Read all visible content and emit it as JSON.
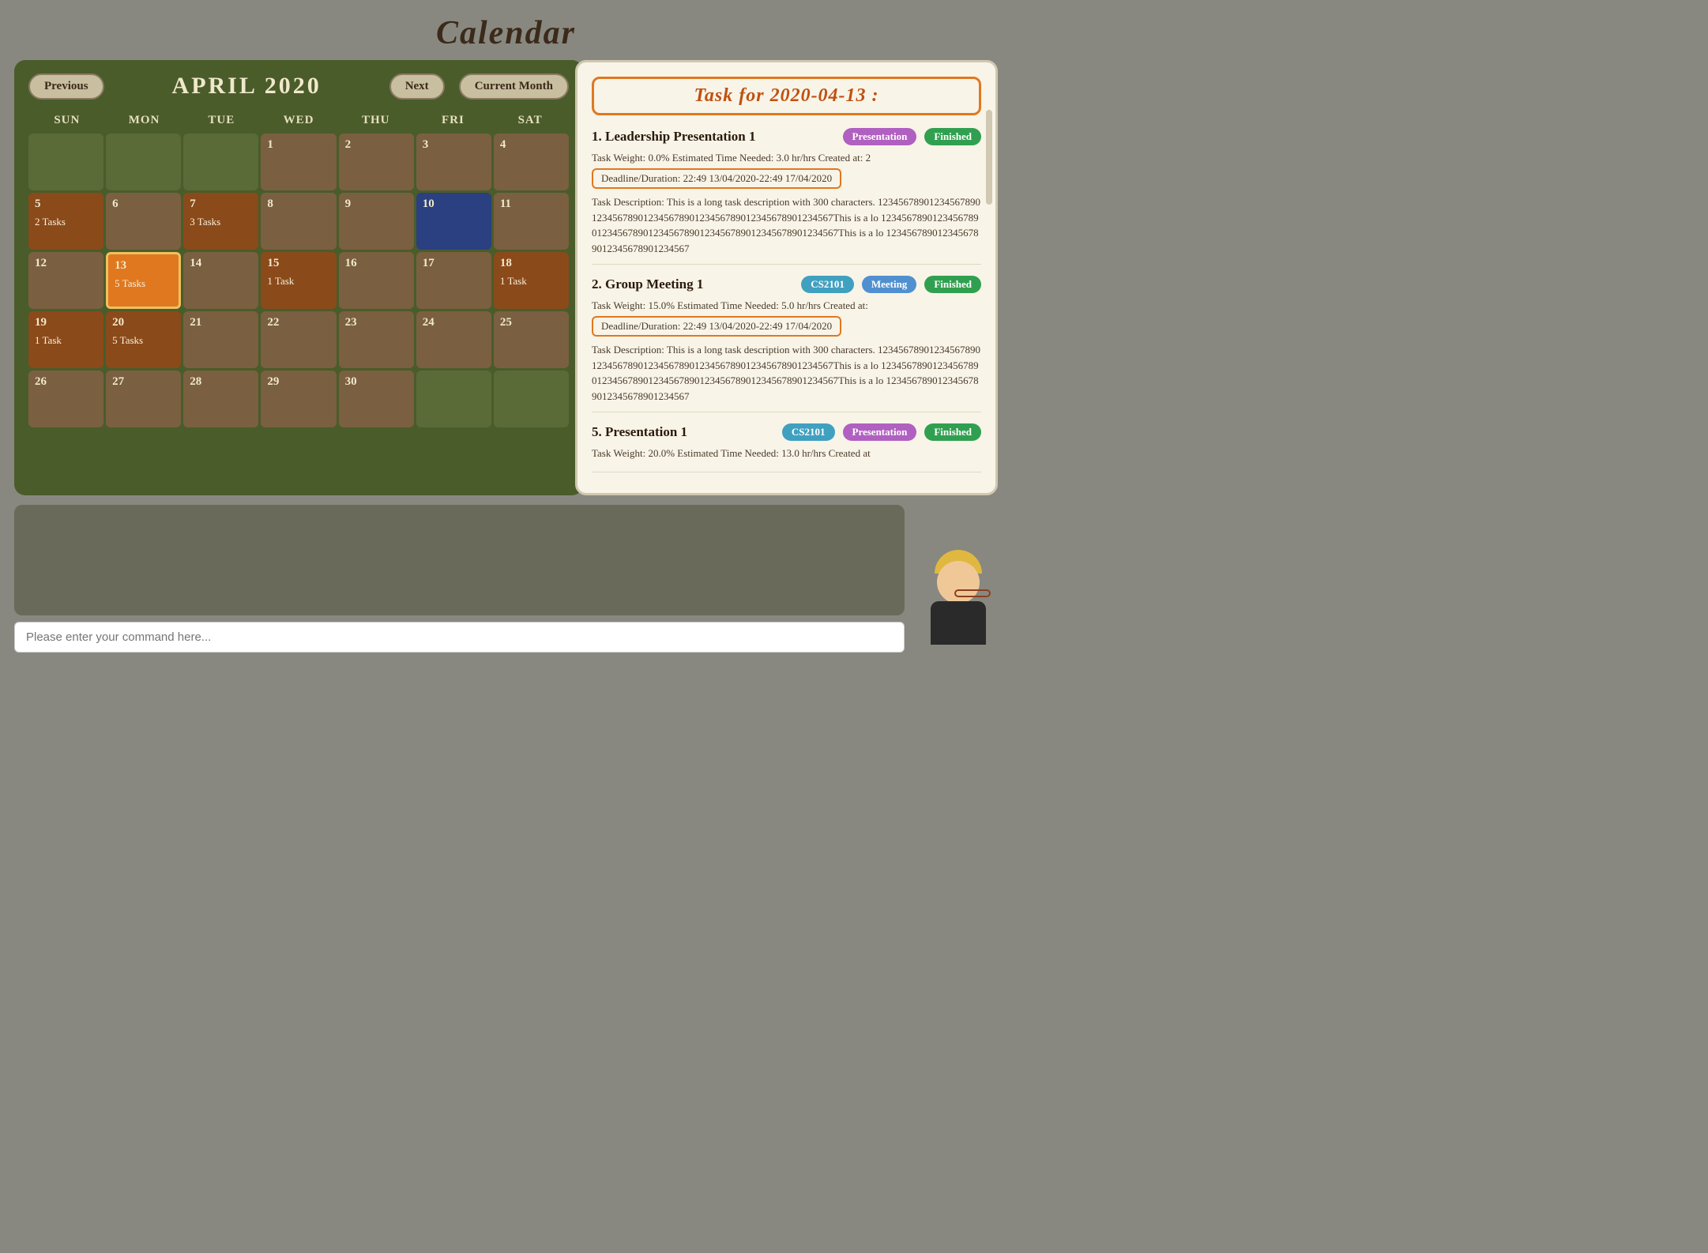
{
  "page": {
    "title": "Calendar"
  },
  "nav": {
    "previous_label": "Previous",
    "next_label": "Next",
    "current_month_label": "Current Month",
    "month_title": "APRIL 2020"
  },
  "calendar": {
    "headers": [
      "SUN",
      "MON",
      "TUE",
      "WED",
      "THU",
      "FRI",
      "SAT"
    ],
    "weeks": [
      [
        {
          "num": "",
          "tasks": "",
          "type": "empty"
        },
        {
          "num": "",
          "tasks": "",
          "type": "empty"
        },
        {
          "num": "",
          "tasks": "",
          "type": "empty"
        },
        {
          "num": "1",
          "tasks": "",
          "type": "normal"
        },
        {
          "num": "2",
          "tasks": "",
          "type": "normal"
        },
        {
          "num": "3",
          "tasks": "",
          "type": "normal"
        },
        {
          "num": "4",
          "tasks": "",
          "type": "normal"
        }
      ],
      [
        {
          "num": "5",
          "tasks": "2 Tasks",
          "type": "has-tasks"
        },
        {
          "num": "6",
          "tasks": "",
          "type": "normal"
        },
        {
          "num": "7",
          "tasks": "3 Tasks",
          "type": "has-tasks"
        },
        {
          "num": "8",
          "tasks": "",
          "type": "normal"
        },
        {
          "num": "9",
          "tasks": "",
          "type": "normal"
        },
        {
          "num": "10",
          "tasks": "",
          "type": "today-highlight"
        },
        {
          "num": "11",
          "tasks": "",
          "type": "normal"
        }
      ],
      [
        {
          "num": "12",
          "tasks": "",
          "type": "normal"
        },
        {
          "num": "13",
          "tasks": "5 Tasks",
          "type": "selected"
        },
        {
          "num": "14",
          "tasks": "",
          "type": "normal"
        },
        {
          "num": "15",
          "tasks": "1 Task",
          "type": "has-tasks"
        },
        {
          "num": "16",
          "tasks": "",
          "type": "normal"
        },
        {
          "num": "17",
          "tasks": "",
          "type": "normal"
        },
        {
          "num": "18",
          "tasks": "1 Task",
          "type": "has-tasks"
        }
      ],
      [
        {
          "num": "19",
          "tasks": "1 Task",
          "type": "has-tasks"
        },
        {
          "num": "20",
          "tasks": "5 Tasks",
          "type": "has-tasks"
        },
        {
          "num": "21",
          "tasks": "",
          "type": "normal"
        },
        {
          "num": "22",
          "tasks": "",
          "type": "normal"
        },
        {
          "num": "23",
          "tasks": "",
          "type": "normal"
        },
        {
          "num": "24",
          "tasks": "",
          "type": "normal"
        },
        {
          "num": "25",
          "tasks": "",
          "type": "normal"
        }
      ],
      [
        {
          "num": "26",
          "tasks": "",
          "type": "normal"
        },
        {
          "num": "27",
          "tasks": "",
          "type": "normal"
        },
        {
          "num": "28",
          "tasks": "",
          "type": "normal"
        },
        {
          "num": "29",
          "tasks": "",
          "type": "normal"
        },
        {
          "num": "30",
          "tasks": "",
          "type": "normal"
        },
        {
          "num": "",
          "tasks": "",
          "type": "empty"
        },
        {
          "num": "",
          "tasks": "",
          "type": "empty"
        }
      ]
    ]
  },
  "task_panel": {
    "title": "Task for 2020-04-13 :",
    "tasks": [
      {
        "num": "1.",
        "title": "Leadership Presentation 1",
        "badges": [
          {
            "label": "Presentation",
            "type": "presentation"
          },
          {
            "label": "Finished",
            "type": "finished"
          }
        ],
        "meta": "Task Weight: 0.0%   Estimated Time Needed: 3.0 hr/hrs   Created at: 2",
        "deadline": "Deadline/Duration: 22:49 13/04/2020-22:49 17/04/2020",
        "description": "Task Description: This is a long task description with 300 characters. 1234567890123456789012345678901234567890123456789012345678901234567This is a lo 1234567890123456789012345678901234567890123456789012345678901234567This is a lo 1234567890123456789012345678901234567"
      },
      {
        "num": "2.",
        "title": "Group Meeting 1",
        "badges": [
          {
            "label": "CS2101",
            "type": "cs2101"
          },
          {
            "label": "Meeting",
            "type": "meeting"
          },
          {
            "label": "Finished",
            "type": "finished"
          }
        ],
        "meta": "Task Weight: 15.0%   Estimated Time Needed: 5.0 hr/hrs   Created at:",
        "deadline": "Deadline/Duration: 22:49 13/04/2020-22:49 17/04/2020",
        "description": "Task Description: This is a long task description with 300 characters. 1234567890123456789012345678901234567890123456789012345678901234567This is a lo 1234567890123456789012345678901234567890123456789012345678901234567This is a lo 1234567890123456789012345678901234567"
      },
      {
        "num": "5.",
        "title": "Presentation 1",
        "badges": [
          {
            "label": "CS2101",
            "type": "cs2101"
          },
          {
            "label": "Presentation",
            "type": "presentation"
          },
          {
            "label": "Finished",
            "type": "finished"
          }
        ],
        "meta": "Task Weight: 20.0%   Estimated Time Needed: 13.0 hr/hrs   Created at",
        "deadline": "",
        "description": ""
      }
    ]
  },
  "bottom": {
    "chat_placeholder": "",
    "command_placeholder": "Please enter your command here..."
  }
}
